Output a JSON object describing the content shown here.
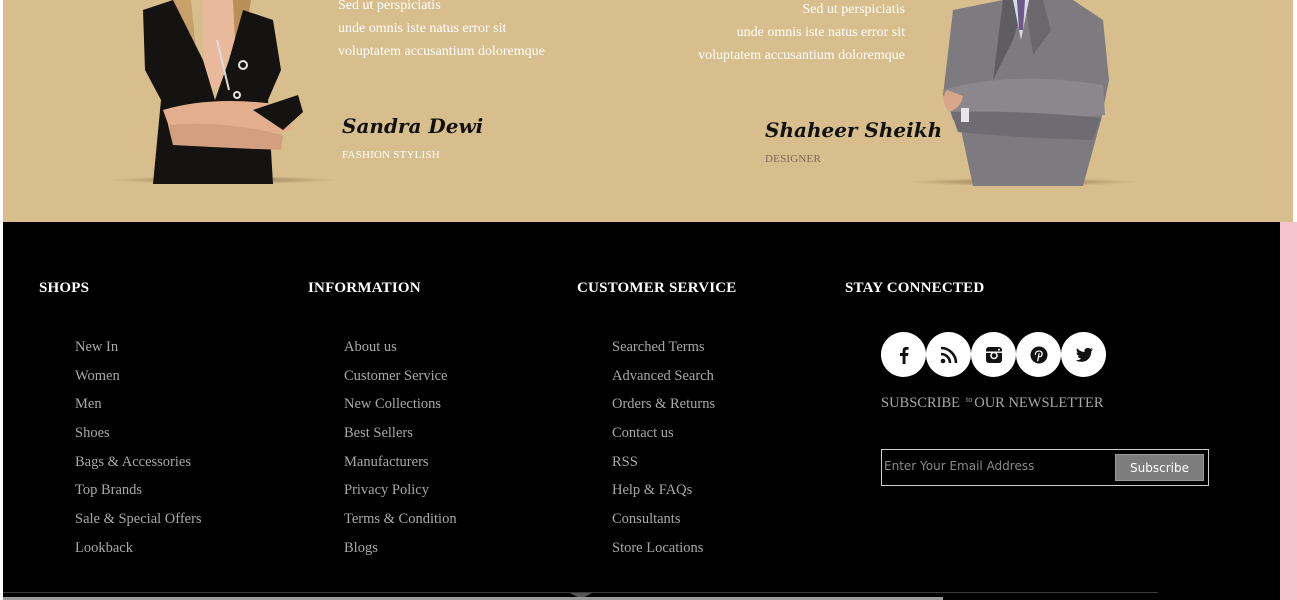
{
  "testimonials": [
    {
      "quote_lines": [
        "Sed ut perspiciatis",
        "unde omnis iste natus error sit",
        "voluptatem accusantium doloremque"
      ],
      "name": "Sandra Dewi",
      "role": "FASHION STYLISH"
    },
    {
      "quote_lines": [
        "Sed ut perspiciatis",
        "unde omnis iste natus error sit",
        "voluptatem accusantium doloremque"
      ],
      "name": "Shaheer Sheikh",
      "role": "DESIGNER"
    }
  ],
  "colors": {
    "band": "#d8be8c",
    "footer": "#000000",
    "link": "#a8a8a8",
    "accent_strip": "#f7c3cc"
  },
  "footer": {
    "shops": {
      "title": "SHOPS",
      "items": [
        "New In",
        "Women",
        "Men",
        "Shoes",
        "Bags & Accessories",
        "Top Brands",
        "Sale & Special Offers",
        "Lookback"
      ]
    },
    "information": {
      "title": "INFORMATION",
      "items": [
        "About us",
        "Customer Service",
        "New Collections",
        "Best Sellers",
        "Manufacturers",
        "Privacy Policy",
        "Terms & Condition",
        "Blogs"
      ]
    },
    "customer_service": {
      "title": "CUSTOMER SERVICE",
      "items": [
        "Searched Terms",
        "Advanced Search",
        "Orders & Returns",
        "Contact us",
        "RSS",
        "Help & FAQs",
        "Consultants",
        "Store Locations"
      ]
    },
    "stay_connected": {
      "title": "STAY CONNECTED",
      "social_icons": [
        "facebook-icon",
        "rss-icon",
        "instagram-icon",
        "pinterest-icon",
        "twitter-icon"
      ],
      "newsletter_prefix": "SUBSCRIBE",
      "newsletter_small": "to",
      "newsletter_suffix": "OUR NEWSLETTER",
      "email_placeholder": "Enter Your Email Address",
      "subscribe_label": "Subscribe"
    }
  }
}
